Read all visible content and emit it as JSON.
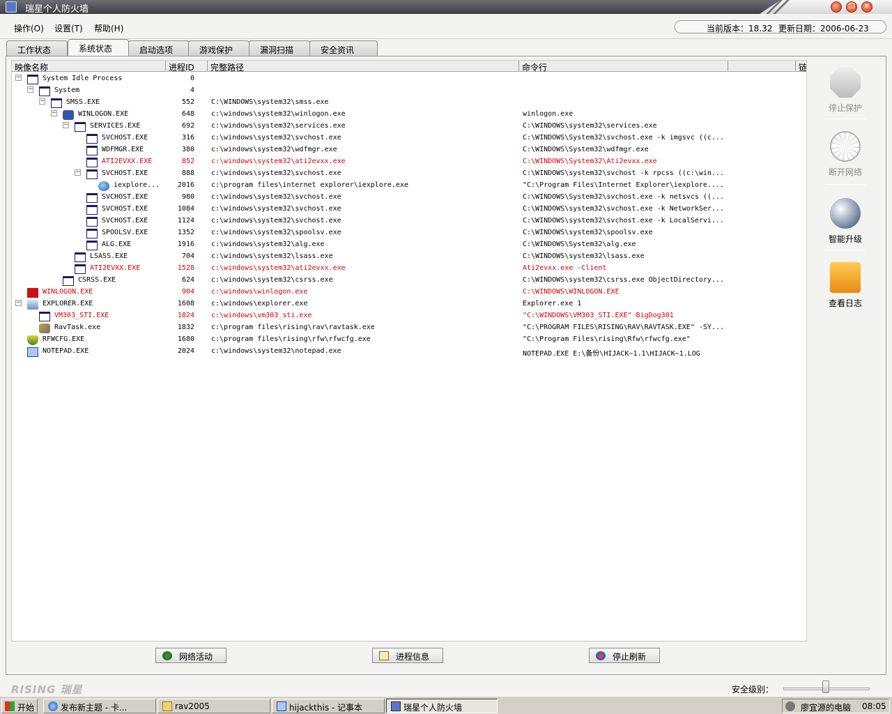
{
  "window": {
    "title": "瑞星个人防火墙"
  },
  "menu": {
    "items": [
      "操作(O)",
      "设置(T)",
      "帮助(H)"
    ]
  },
  "version": {
    "current_label": "当前版本：18.32",
    "date_label": "更新日期：2006-06-23"
  },
  "tabs": [
    {
      "label": "工作状态"
    },
    {
      "label": "系统状态"
    },
    {
      "label": "启动选项"
    },
    {
      "label": "游戏保护"
    },
    {
      "label": "漏洞扫描"
    },
    {
      "label": "安全资讯"
    }
  ],
  "grid": {
    "columns": [
      "映像名称",
      "进程ID",
      "完整路径",
      "命令行",
      "",
      "链"
    ],
    "rows": [
      {
        "name": "System Idle Process",
        "pid": "0",
        "path": "",
        "cmd": ""
      },
      {
        "name": "System",
        "pid": "4",
        "path": "",
        "cmd": ""
      },
      {
        "name": "SMSS.EXE",
        "pid": "552",
        "path": "C:\\WINDOWS\\system32\\smss.exe",
        "cmd": ""
      },
      {
        "name": "WINLOGON.EXE",
        "pid": "648",
        "path": "c:\\windows\\system32\\winlogon.exe",
        "cmd": "winlogon.exe"
      },
      {
        "name": "SERVICES.EXE",
        "pid": "692",
        "path": "c:\\windows\\system32\\services.exe",
        "cmd": "C:\\WINDOWS\\system32\\services.exe"
      },
      {
        "name": "SVCHOST.EXE",
        "pid": "316",
        "path": "c:\\windows\\system32\\svchost.exe",
        "cmd": "C:\\WINDOWS\\System32\\svchost.exe -k imgsvc ((c..."
      },
      {
        "name": "WDFMGR.EXE",
        "pid": "380",
        "path": "c:\\windows\\system32\\wdfmgr.exe",
        "cmd": "C:\\WINDOWS\\System32\\wdfmgr.exe"
      },
      {
        "name": "ATI2EVXX.EXE",
        "pid": "852",
        "path": "c:\\windows\\system32\\ati2evxx.exe",
        "cmd": "C:\\WINDOWS\\System32\\Ati2evxx.exe"
      },
      {
        "name": "SVCHOST.EXE",
        "pid": "888",
        "path": "c:\\windows\\system32\\svchost.exe",
        "cmd": "C:\\WINDOWS\\system32\\svchost -k rpcss ((c:\\win..."
      },
      {
        "name": "iexplore...",
        "pid": "2016",
        "path": "c:\\program files\\internet explorer\\iexplore.exe",
        "cmd": "\"C:\\Program Files\\Internet Explorer\\iexplore...."
      },
      {
        "name": "SVCHOST.EXE",
        "pid": "980",
        "path": "c:\\windows\\system32\\svchost.exe",
        "cmd": "C:\\WINDOWS\\System32\\svchost.exe -k netsvcs ((..."
      },
      {
        "name": "SVCHOST.EXE",
        "pid": "1084",
        "path": "c:\\windows\\system32\\svchost.exe",
        "cmd": "C:\\WINDOWS\\system32\\svchost.exe -k NetworkSer..."
      },
      {
        "name": "SVCHOST.EXE",
        "pid": "1124",
        "path": "c:\\windows\\system32\\svchost.exe",
        "cmd": "C:\\WINDOWS\\system32\\svchost.exe -k LocalServi..."
      },
      {
        "name": "SPOOLSV.EXE",
        "pid": "1352",
        "path": "c:\\windows\\system32\\spoolsv.exe",
        "cmd": "C:\\WINDOWS\\system32\\spoolsv.exe"
      },
      {
        "name": "ALG.EXE",
        "pid": "1916",
        "path": "c:\\windows\\system32\\alg.exe",
        "cmd": "C:\\WINDOWS\\System32\\alg.exe"
      },
      {
        "name": "LSASS.EXE",
        "pid": "704",
        "path": "c:\\windows\\system32\\lsass.exe",
        "cmd": "C:\\WINDOWS\\system32\\lsass.exe"
      },
      {
        "name": "ATI2EVXX.EXE",
        "pid": "1528",
        "path": "c:\\windows\\system32\\ati2evxx.exe",
        "cmd": "Ati2evxx.exe -Client"
      },
      {
        "name": "CSRSS.EXE",
        "pid": "624",
        "path": "c:\\windows\\system32\\csrss.exe",
        "cmd": "C:\\WINDOWS\\system32\\csrss.exe ObjectDirectory..."
      },
      {
        "name": "WINLOGON.EXE",
        "pid": "904",
        "path": "c:\\windows\\winlogon.exe",
        "cmd": "C:\\WINDOWS\\WINLOGON.EXE"
      },
      {
        "name": "EXPLORER.EXE",
        "pid": "1608",
        "path": "c:\\windows\\explorer.exe",
        "cmd": "Explorer.exe 1"
      },
      {
        "name": "VM303_STI.EXE",
        "pid": "1824",
        "path": "c:\\windows\\vm303_sti.exe",
        "cmd": "\"C:\\WINDOWS\\VM303_STI.EXE\" BigDog301"
      },
      {
        "name": "RavTask.exe",
        "pid": "1832",
        "path": "c:\\program files\\rising\\rav\\ravtask.exe",
        "cmd": "\"C:\\PROGRAM FILES\\RISING\\RAV\\RAVTASK.EXE\" -SY..."
      },
      {
        "name": "RFWCFG.EXE",
        "pid": "1680",
        "path": "c:\\program files\\rising\\rfw\\rfwcfg.exe",
        "cmd": "\"C:\\Program Files\\rising\\Rfw\\rfwcfg.exe\""
      },
      {
        "name": "NOTEPAD.EXE",
        "pid": "2024",
        "path": "c:\\windows\\system32\\notepad.exe",
        "cmd": "NOTEPAD.EXE E:\\备份\\HIJACK~1.1\\HIJACK~1.LOG"
      }
    ]
  },
  "actions": {
    "network": "网络活动",
    "process_info": "进程信息",
    "stop_refresh": "停止刷新"
  },
  "sidebar": {
    "stop_protect": "停止保护",
    "disconnect": "断开网络",
    "upgrade": "智能升级",
    "view_log": "查看日志"
  },
  "status": {
    "logo": "RISING 瑞星",
    "security_level_label": "安全级别："
  },
  "taskbar": {
    "start": "开始",
    "tasks": [
      "发布新主题 - 卡...",
      "rav2005",
      "hijackthis - 记事本",
      "瑞星个人防火墙"
    ],
    "tray_user": "廖宜源的电脑",
    "clock": "08:05"
  },
  "colors": {
    "alert_red": "#d40000",
    "titlebar": "#4a4a52"
  }
}
